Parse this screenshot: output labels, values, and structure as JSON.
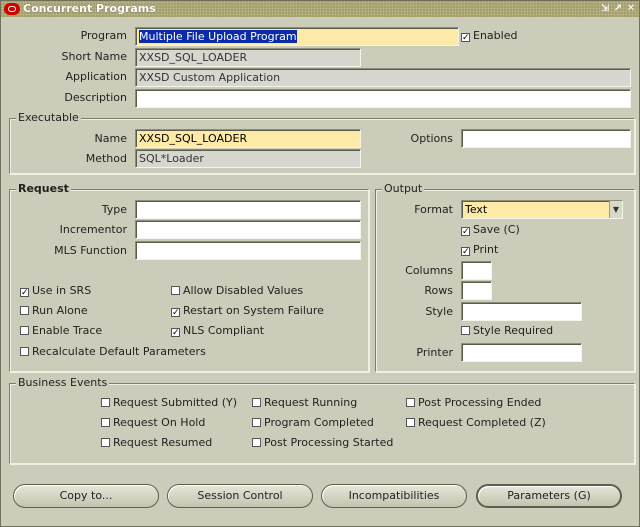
{
  "window": {
    "title": "Concurrent Programs",
    "buttons": [
      "⇲",
      "↗",
      "✕"
    ]
  },
  "header": {
    "program_label": "Program",
    "program_value": "Multiple File Upload Program",
    "enabled_label": "Enabled",
    "enabled_checked": true,
    "short_name_label": "Short Name",
    "short_name_value": "XXSD_SQL_LOADER",
    "application_label": "Application",
    "application_value": "XXSD Custom Application",
    "description_label": "Description",
    "description_value": ""
  },
  "executable": {
    "title": "Executable",
    "name_label": "Name",
    "name_value": "XXSD_SQL_LOADER",
    "options_label": "Options",
    "options_value": "",
    "method_label": "Method",
    "method_value": "SQL*Loader"
  },
  "request": {
    "title": "Request",
    "type_label": "Type",
    "incrementor_label": "Incrementor",
    "mls_label": "MLS Function",
    "checkboxes": [
      {
        "label": "Use in SRS",
        "checked": true
      },
      {
        "label": "Allow Disabled Values",
        "checked": false
      },
      {
        "label": "Run Alone",
        "checked": false
      },
      {
        "label": "Restart on System Failure",
        "checked": true
      },
      {
        "label": "Enable Trace",
        "checked": false
      },
      {
        "label": "NLS Compliant",
        "checked": true
      },
      {
        "label": "Recalculate Default Parameters",
        "checked": false
      }
    ]
  },
  "output": {
    "title": "Output",
    "format_label": "Format",
    "format_value": "Text",
    "save_label": "Save (C)",
    "save_checked": true,
    "print_label": "Print",
    "print_checked": true,
    "columns_label": "Columns",
    "rows_label": "Rows",
    "style_label": "Style",
    "style_required_label": "Style Required",
    "style_required_checked": false,
    "printer_label": "Printer"
  },
  "business_events": {
    "title": "Business Events",
    "items": [
      {
        "label": "Request Submitted (Y)",
        "checked": false
      },
      {
        "label": "Request Running",
        "checked": false
      },
      {
        "label": "Post Processing Ended",
        "checked": false
      },
      {
        "label": "Request On Hold",
        "checked": false
      },
      {
        "label": "Program Completed",
        "checked": false
      },
      {
        "label": "Request Completed (Z)",
        "checked": false
      },
      {
        "label": "Request Resumed",
        "checked": false
      },
      {
        "label": "Post Processing Started",
        "checked": false
      }
    ]
  },
  "footer": {
    "copy_to": "Copy to...",
    "session_control": "Session Control",
    "incompatibilities": "Incompatibilities",
    "parameters": "Parameters (G)"
  },
  "colors": {
    "required_field": "#fceaa6",
    "readonly_field": "#d7d7d0",
    "selection": "#0a2ca8",
    "background": "#ccccba"
  }
}
